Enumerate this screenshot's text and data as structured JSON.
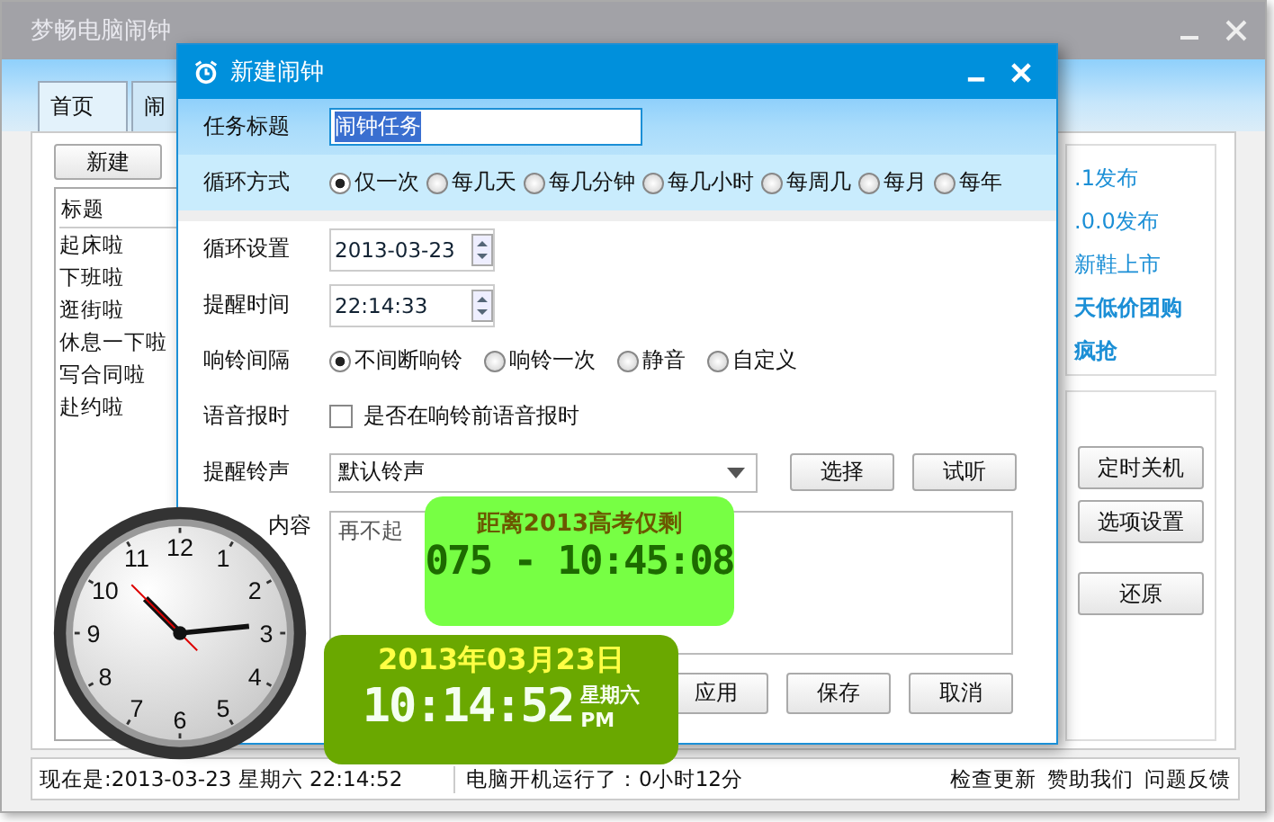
{
  "window": {
    "title": "梦畅电脑闹钟"
  },
  "tabs": [
    {
      "label": "首页",
      "selected": true
    },
    {
      "label": "闹",
      "selected": false
    }
  ],
  "left_panel": {
    "new_button": "新建",
    "list_header": "标题",
    "items": [
      {
        "label": "起床啦",
        "selected": false
      },
      {
        "label": "下班啦",
        "selected": false
      },
      {
        "label": "逛街啦",
        "selected": false
      },
      {
        "label": "休息一下啦",
        "selected": false
      },
      {
        "label": "写合同啦",
        "selected": false
      },
      {
        "label": "赴约啦",
        "selected": false
      }
    ]
  },
  "news": [
    {
      "text": ".1发布",
      "bold": false
    },
    {
      "text": ".0.0发布",
      "bold": false
    },
    {
      "text": "新鞋上市",
      "bold": false
    },
    {
      "text": "天低价团购",
      "bold": true
    },
    {
      "text": "疯抢",
      "bold": true
    }
  ],
  "side_buttons": [
    "定时关机",
    "选项设置",
    "还原"
  ],
  "status_bar": {
    "now": "现在是:2013-03-23 星期六  22:14:52",
    "uptime": "电脑开机运行了：0小时12分",
    "links": [
      "检查更新",
      "赞助我们",
      "问题反馈"
    ]
  },
  "dialog": {
    "title": "新建闹钟",
    "rows": [
      {
        "kind": "text",
        "label": "任务标题",
        "value": "闹钟任务"
      },
      {
        "kind": "radio",
        "label": "循环方式",
        "options": [
          {
            "label": "仅一次",
            "selected": true
          },
          {
            "label": "每几天",
            "selected": false
          },
          {
            "label": "每几分钟",
            "selected": false
          },
          {
            "label": "每几小时",
            "selected": false
          },
          {
            "label": "每周几",
            "selected": false
          },
          {
            "label": "每月",
            "selected": false
          },
          {
            "label": "每年",
            "selected": false
          }
        ]
      },
      {
        "kind": "spin",
        "label": "循环设置",
        "value": "2013-03-23"
      },
      {
        "kind": "spin",
        "label": "提醒时间",
        "value": "22:14:33"
      },
      {
        "kind": "radio",
        "label": "响铃间隔",
        "options": [
          {
            "label": "不间断响铃",
            "selected": true
          },
          {
            "label": "响铃一次",
            "selected": false
          },
          {
            "label": "静音",
            "selected": false
          },
          {
            "label": "自定义",
            "selected": false
          }
        ]
      },
      {
        "kind": "check",
        "label": "语音报时",
        "text": "是否在响铃前语音报时",
        "checked": false
      },
      {
        "kind": "select",
        "label": "提醒铃声",
        "value": "默认铃声",
        "buttons": [
          "选择",
          "试听"
        ]
      },
      {
        "kind": "memo",
        "label": "内容",
        "value": "再不起"
      }
    ],
    "buttons": [
      "应用",
      "保存",
      "取消"
    ]
  },
  "countdown_widget": {
    "title": "距离2013高考仅剩",
    "digits": "075 - 10:45:08"
  },
  "date_widget": {
    "date": "2013年03月23日",
    "time": "10:14:52",
    "weekday": "星期六",
    "ampm": "PM"
  },
  "clock": {
    "dial_numbers": [
      "11",
      "12",
      "1",
      "10",
      "2",
      "9",
      "3",
      "8",
      "4",
      "7",
      "6",
      "5"
    ]
  }
}
